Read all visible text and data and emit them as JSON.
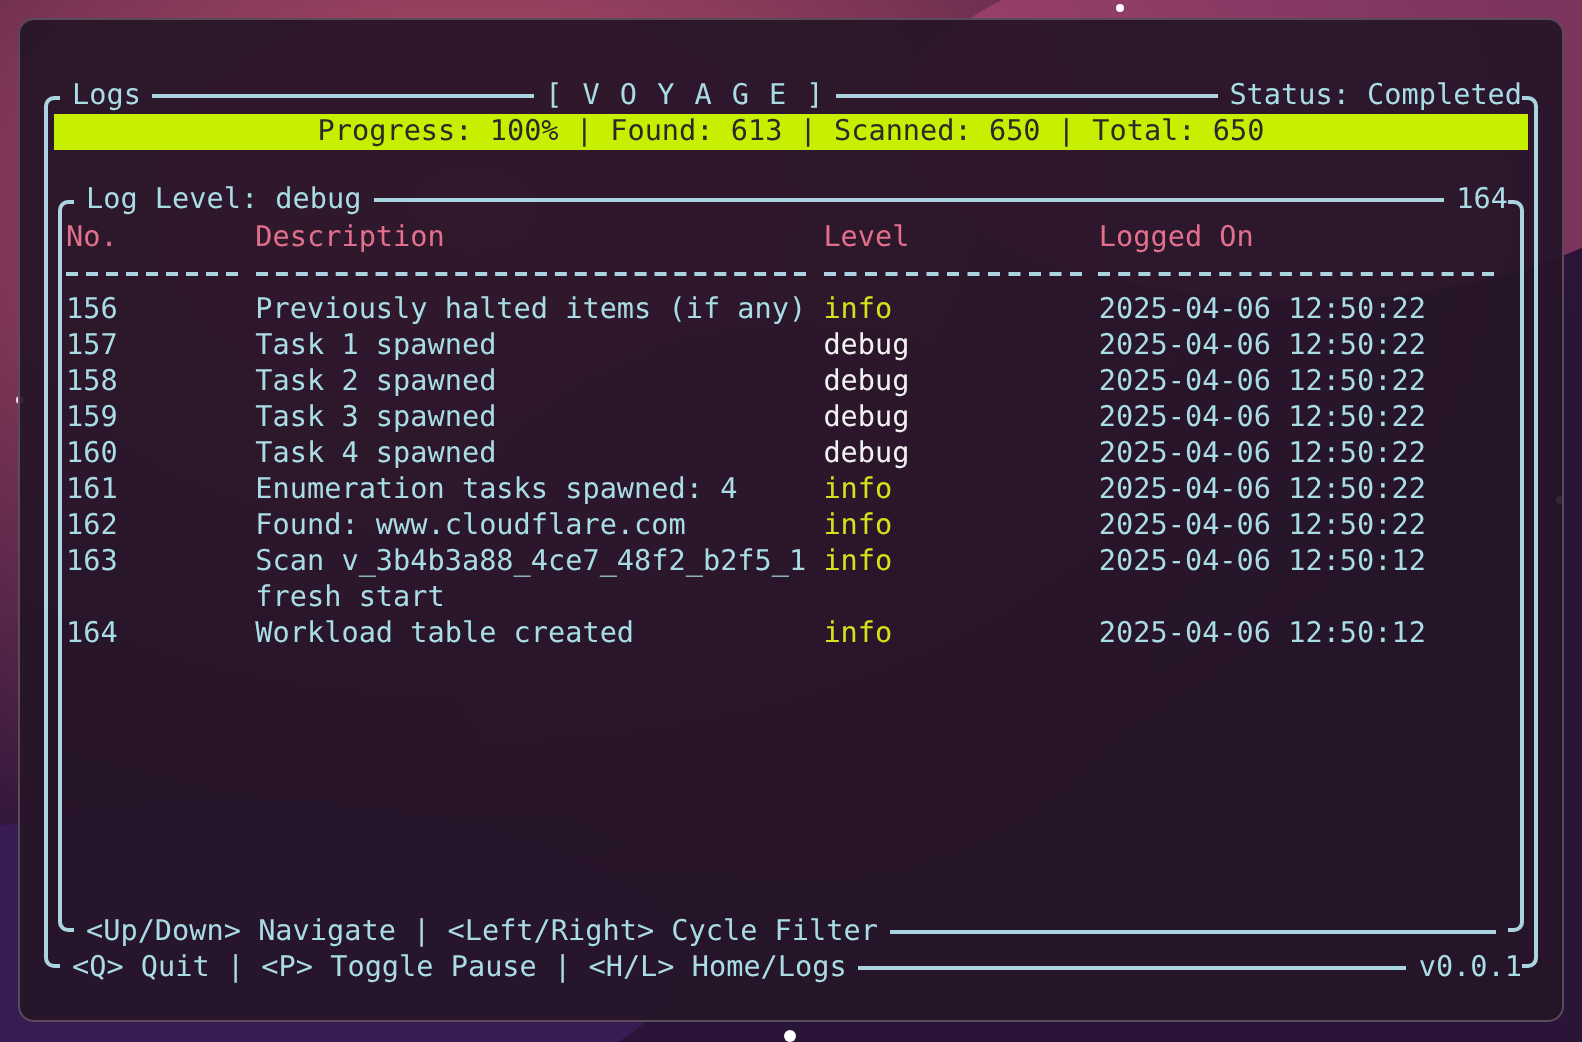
{
  "header": {
    "panel": "Logs",
    "title": "[ V O Y A G E ]",
    "status": "Status: Completed"
  },
  "progress_bar": {
    "text": "Progress: 100% | Found: 613 | Scanned: 650 | Total: 650"
  },
  "log_panel": {
    "title": "Log Level: debug",
    "count": "164",
    "columns": [
      "No.",
      "Description",
      "Level",
      "Logged On"
    ],
    "rows": [
      {
        "no": "156",
        "description": "Previously halted items (if any)",
        "level": "info",
        "color": "#d4e21c",
        "logged_on": "2025-04-06 12:50:22"
      },
      {
        "no": "157",
        "description": "Task 1 spawned",
        "level": "debug",
        "color": "#f2f2f2",
        "logged_on": "2025-04-06 12:50:22"
      },
      {
        "no": "158",
        "description": "Task 2 spawned",
        "level": "debug",
        "color": "#f2f2f2",
        "logged_on": "2025-04-06 12:50:22"
      },
      {
        "no": "159",
        "description": "Task 3 spawned",
        "level": "debug",
        "color": "#f2f2f2",
        "logged_on": "2025-04-06 12:50:22"
      },
      {
        "no": "160",
        "description": "Task 4 spawned",
        "level": "debug",
        "color": "#f2f2f2",
        "logged_on": "2025-04-06 12:50:22"
      },
      {
        "no": "161",
        "description": "Enumeration tasks spawned: 4",
        "level": "info",
        "color": "#d4e21c",
        "logged_on": "2025-04-06 12:50:22"
      },
      {
        "no": "162",
        "description": "Found: www.cloudflare.com",
        "level": "info",
        "color": "#d4e21c",
        "logged_on": "2025-04-06 12:50:22"
      },
      {
        "no": "163",
        "description": "Scan v_3b4b3a88_4ce7_48f2_b2f5_1 fresh start",
        "level": "info",
        "color": "#d4e21c",
        "logged_on": "2025-04-06 12:50:12"
      },
      {
        "no": "164",
        "description": "Workload table created",
        "level": "info",
        "color": "#d4e21c",
        "logged_on": "2025-04-06 12:50:12"
      }
    ],
    "hint": "<Up/Down> Navigate | <Left/Right> Cycle Filter"
  },
  "footer": {
    "hint": "<Q> Quit | <P> Toggle Pause | <H/L> Home/Logs",
    "version": "v0.0.1"
  }
}
